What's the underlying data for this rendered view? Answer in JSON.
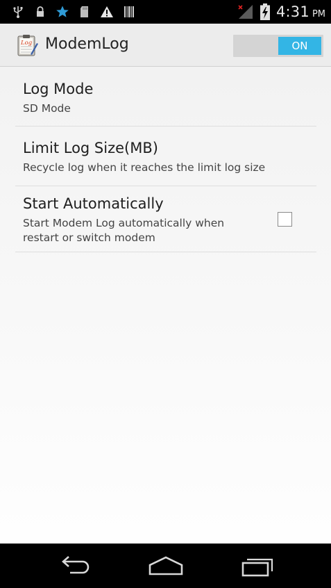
{
  "status_bar": {
    "icons": [
      "usb-icon",
      "lock-icon",
      "star-icon",
      "sd-card-icon",
      "warning-icon",
      "barcode-icon"
    ],
    "signal_icon": "signal-no-service-icon",
    "battery_icon": "battery-charging-icon",
    "time": "4:31",
    "ampm": "PM"
  },
  "action_bar": {
    "app_icon": "log-clipboard-icon",
    "app_icon_text": "Log",
    "title": "ModemLog",
    "toggle_label": "ON",
    "toggle_on": true
  },
  "preferences": [
    {
      "title": "Log Mode",
      "summary": "SD Mode"
    },
    {
      "title": "Limit Log Size(MB)",
      "summary": "Recycle log when it reaches the limit log size"
    },
    {
      "title": "Start Automatically",
      "summary_line1": "Start Modem Log automatically when",
      "summary_line2": "restart or switch modem",
      "checked": false
    }
  ],
  "nav_bar": {
    "back_icon": "back-icon",
    "home_icon": "home-icon",
    "recents_icon": "recent-apps-icon"
  },
  "colors": {
    "accent": "#33b5e5",
    "status_bar": "#000000",
    "action_bar": "#ececec"
  }
}
